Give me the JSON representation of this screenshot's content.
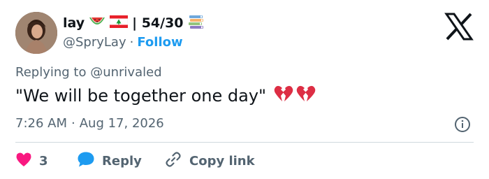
{
  "author": {
    "display_name": "lay",
    "flags": "🍉🇱🇧",
    "bio_suffix": "| 54/30",
    "handle": "@SpryLay",
    "separator": "·",
    "follow_label": "Follow"
  },
  "tweet": {
    "replying_to_prefix": "Replying to",
    "replying_to_user": "@unrivaled",
    "text": "\"We will be together one day\"",
    "time": "7:26 AM",
    "date_separator": "·",
    "date": "Aug 17, 2026"
  },
  "actions": {
    "like_count": "3",
    "reply_label": "Reply",
    "copy_link_label": "Copy link"
  },
  "colors": {
    "accent": "#1d9bf0",
    "like": "#f91880",
    "muted": "#536471",
    "text": "#0f1419"
  },
  "icons": [
    "avatar",
    "watermelon-icon",
    "lebanon-flag-icon",
    "books-icon",
    "x-logo-icon",
    "broken-heart-icon",
    "info-icon",
    "heart-icon",
    "reply-bubble-icon",
    "link-icon"
  ]
}
